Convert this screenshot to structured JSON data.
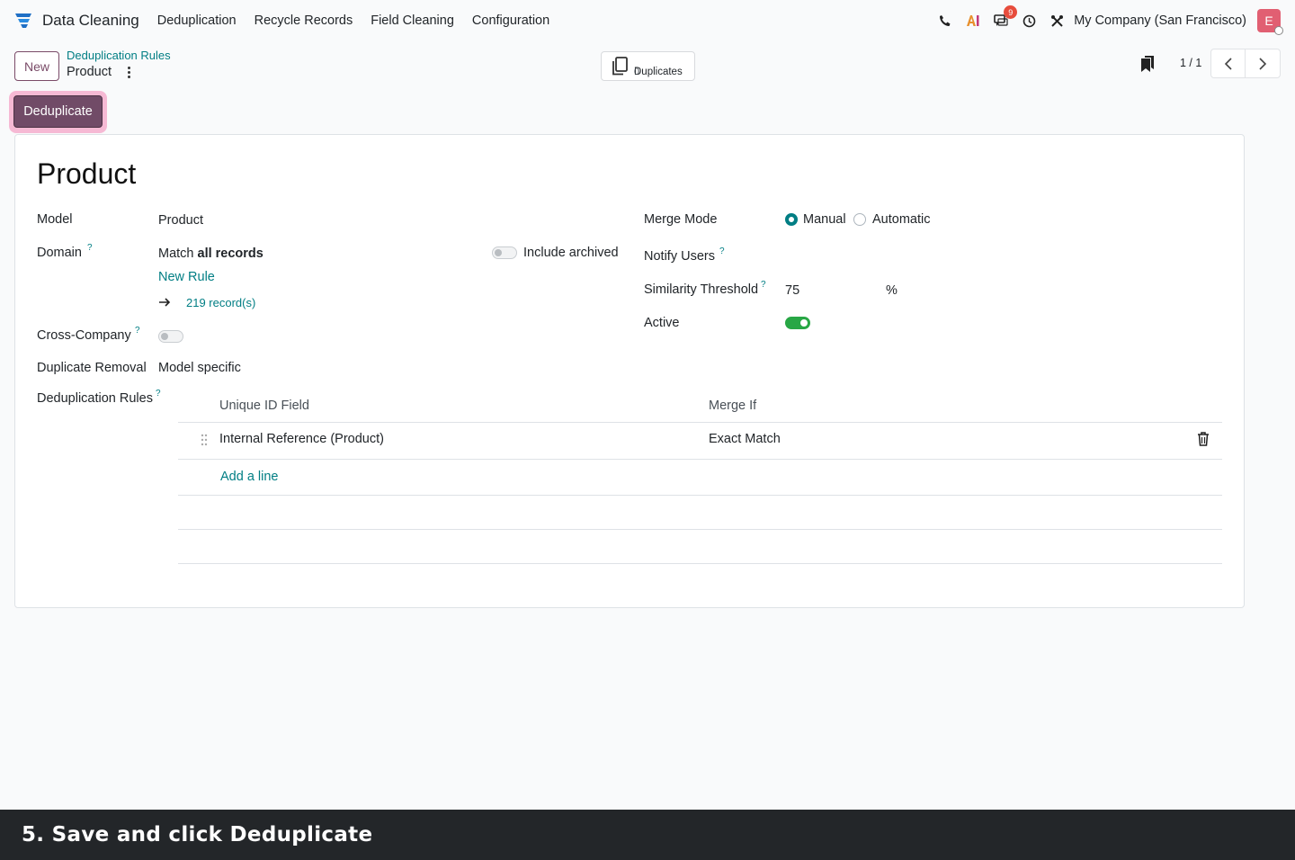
{
  "navbar": {
    "app_name": "Data Cleaning",
    "menu": [
      "Deduplication",
      "Recycle Records",
      "Field Cleaning",
      "Configuration"
    ],
    "messages_badge": "9",
    "company": "My Company (San Francisco)",
    "avatar_letter": "E"
  },
  "control": {
    "new_label": "New",
    "breadcrumb_parent": "Deduplication Rules",
    "breadcrumb_current": "Product",
    "smart_button_label": "Duplicates",
    "smart_button_value": "0",
    "pager": "1 / 1",
    "deduplicate_label": "Deduplicate"
  },
  "form": {
    "title": "Product",
    "model_label": "Model",
    "model_value": "Product",
    "domain_label": "Domain",
    "domain_prefix": "Match ",
    "domain_bold": "all records",
    "include_archived_label": "Include archived",
    "new_rule_label": "New Rule",
    "records_link": "219 record(s)",
    "cross_company_label": "Cross-Company",
    "duplicate_removal_label": "Duplicate Removal",
    "duplicate_removal_value": "Model specific",
    "dedup_rules_label": "Deduplication Rules",
    "merge_mode_label": "Merge Mode",
    "merge_mode_options": [
      "Manual",
      "Automatic"
    ],
    "notify_users_label": "Notify Users",
    "similarity_label": "Similarity Threshold",
    "similarity_value": "75",
    "similarity_unit": "%",
    "active_label": "Active",
    "help_mark": "?"
  },
  "rules_table": {
    "columns": [
      "Unique ID Field",
      "Merge If"
    ],
    "rows": [
      {
        "field": "Internal Reference (Product)",
        "merge_if": "Exact Match"
      }
    ],
    "add_line_label": "Add a line"
  },
  "banner": {
    "text": "5. Save and click Deduplicate"
  },
  "colors": {
    "primary": "#714b67",
    "link": "#017e84",
    "active_toggle": "#28a745",
    "highlight": "#f6b9d4"
  }
}
